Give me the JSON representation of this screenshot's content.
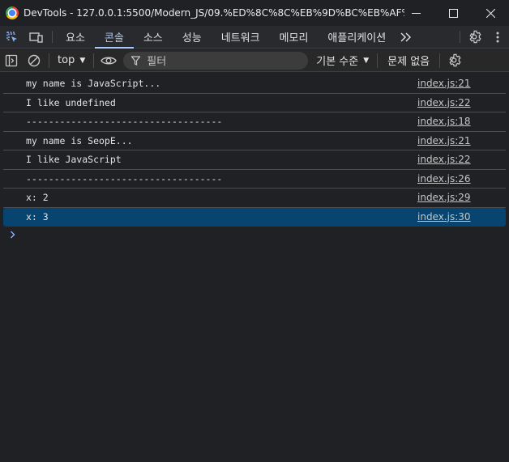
{
  "window": {
    "title": "DevTools - 127.0.0.1:5500/Modern_JS/09.%ED%8C%8C%EB%9D%BC%EB%AF%B8%..."
  },
  "tabs": [
    {
      "label": "요소"
    },
    {
      "label": "콘솔"
    },
    {
      "label": "소스"
    },
    {
      "label": "성능"
    },
    {
      "label": "네트워크"
    },
    {
      "label": "메모리"
    },
    {
      "label": "애플리케이션"
    }
  ],
  "toolbar": {
    "context": "top",
    "filter_placeholder": "필터",
    "levels": "기본 수준",
    "issues": "문제 없음"
  },
  "console": {
    "messages": [
      {
        "text": "my name is JavaScript...",
        "source": "index.js:21"
      },
      {
        "text": "I like undefined",
        "source": "index.js:22"
      },
      {
        "text": "-----------------------------------",
        "source": "index.js:18"
      },
      {
        "text": "my name is SeopE...",
        "source": "index.js:21"
      },
      {
        "text": "I like JavaScript",
        "source": "index.js:22"
      },
      {
        "text": "-----------------------------------",
        "source": "index.js:26"
      },
      {
        "text": "x: 2",
        "source": "index.js:29"
      },
      {
        "text": "x: 3",
        "source": "index.js:30"
      }
    ],
    "selected_index": 7
  },
  "icons": [
    "chrome-icon",
    "minimize-icon",
    "maximize-icon",
    "close-icon",
    "inspect-element-icon",
    "device-toolbar-icon",
    "more-tabs-icon",
    "settings-icon",
    "kebab-menu-icon",
    "sidebar-toggle-icon",
    "clear-console-icon",
    "live-expression-eye-icon",
    "filter-icon",
    "console-settings-icon",
    "prompt-chevron-icon"
  ]
}
